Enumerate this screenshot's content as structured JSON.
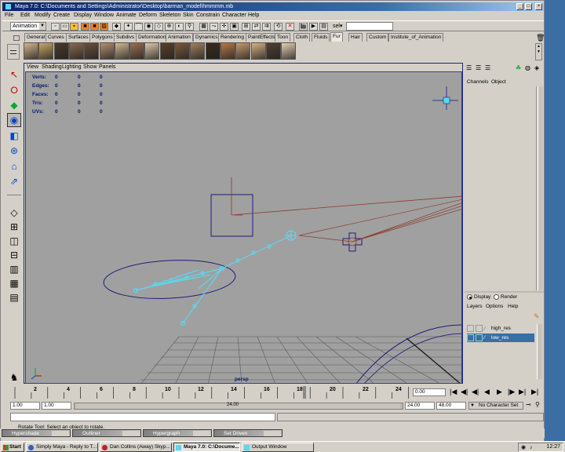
{
  "window": {
    "title": "Maya 7.0: C:\\Documents and Settings\\Administrator\\Desktop\\barman_model\\hmmmm.mb",
    "controls": [
      "_",
      "□",
      "×"
    ]
  },
  "menubar": [
    "File",
    "Edit",
    "Modify",
    "Create",
    "Display",
    "Window",
    "Animate",
    "Deform",
    "Skeleton",
    "Skin",
    "Constrain",
    "Character",
    "Help"
  ],
  "status_line": {
    "menu_set": "Animation",
    "selection_field_label": "sel▾",
    "selection_field_value": ""
  },
  "shelf_tabs": [
    "General",
    "Curves",
    "Surfaces",
    "Polygons",
    "Subdivs",
    "Deformation",
    "Animation",
    "Dynamics",
    "Rendering",
    "PaintEffects",
    "Toon",
    "Cloth",
    "Fluids",
    "Fur",
    "Hair",
    "Custom",
    "Institute_of_Animation"
  ],
  "shelf_active_tab": "Fur",
  "fur_swatch_colors": [
    "#d2b48c",
    "#c8a868",
    "#4a3a2a",
    "#8a6a4a",
    "#6a5038",
    "#b09070",
    "#d0b890",
    "#9a7050",
    "#e0c8a8",
    "#5a4028",
    "#7a5a3a",
    "#a08060",
    "#3a2a1a",
    "#b87848",
    "#c89a6a",
    "#d8b080",
    "#504030",
    "#e4d0b0"
  ],
  "viewport": {
    "menu": [
      "View",
      "Shading",
      "Lighting",
      "Show",
      "Panels"
    ],
    "hud": [
      {
        "label": "Verts:",
        "values": [
          "0",
          "0",
          "0"
        ]
      },
      {
        "label": "Edges:",
        "values": [
          "0",
          "0",
          "0"
        ]
      },
      {
        "label": "Faces:",
        "values": [
          "0",
          "0",
          "0"
        ]
      },
      {
        "label": "Tris:",
        "values": [
          "0",
          "0",
          "0"
        ]
      },
      {
        "label": "UVs:",
        "values": [
          "0",
          "0",
          "0"
        ]
      }
    ],
    "camera_label": "persp",
    "colors": {
      "background": "#a0a0a0",
      "grid": "#5a5a5a",
      "curves": "#1c1c7a",
      "selected_joints": "#5ad8f0",
      "locator_lines": "#8a3a2a"
    }
  },
  "channel_box": {
    "tabs": [
      "Channels",
      "Object"
    ]
  },
  "layer_editor": {
    "mode_display": "Display",
    "mode_render": "Render",
    "menu": [
      "Layers",
      "Options",
      "Help"
    ],
    "layers": [
      {
        "name": "high_res",
        "selected": false
      },
      {
        "name": "low_res",
        "selected": true
      }
    ],
    "selection_color": "#3a6ea5"
  },
  "time_slider": {
    "ticks": [
      "2",
      "4",
      "6",
      "8",
      "10",
      "12",
      "14",
      "16",
      "18",
      "20",
      "22",
      "24"
    ],
    "current_time": "0.00",
    "current_frame_highlight": "18"
  },
  "range_slider": {
    "start_time": "1.00",
    "playback_start": "1.00",
    "playback_end": "24.00",
    "end_time": "48.00",
    "range_thumb_label": "24.00",
    "character_set": "No Character Set"
  },
  "help_line": "Rotate Tool: Select an object to rotate.",
  "minimized_windows": [
    "Hypershade",
    "Outliner",
    "Hypergraph",
    "Set Driven"
  ],
  "taskbar": {
    "start": "Start",
    "tasks": [
      {
        "label": "Simply Maya - Reply to T...",
        "active": false
      },
      {
        "label": "Dan Collins (Away) Skyp...",
        "active": false
      },
      {
        "label": "Maya 7.0: C:\\Docume...",
        "active": true
      },
      {
        "label": "Output Window",
        "active": false
      }
    ],
    "clock": "12:27"
  }
}
